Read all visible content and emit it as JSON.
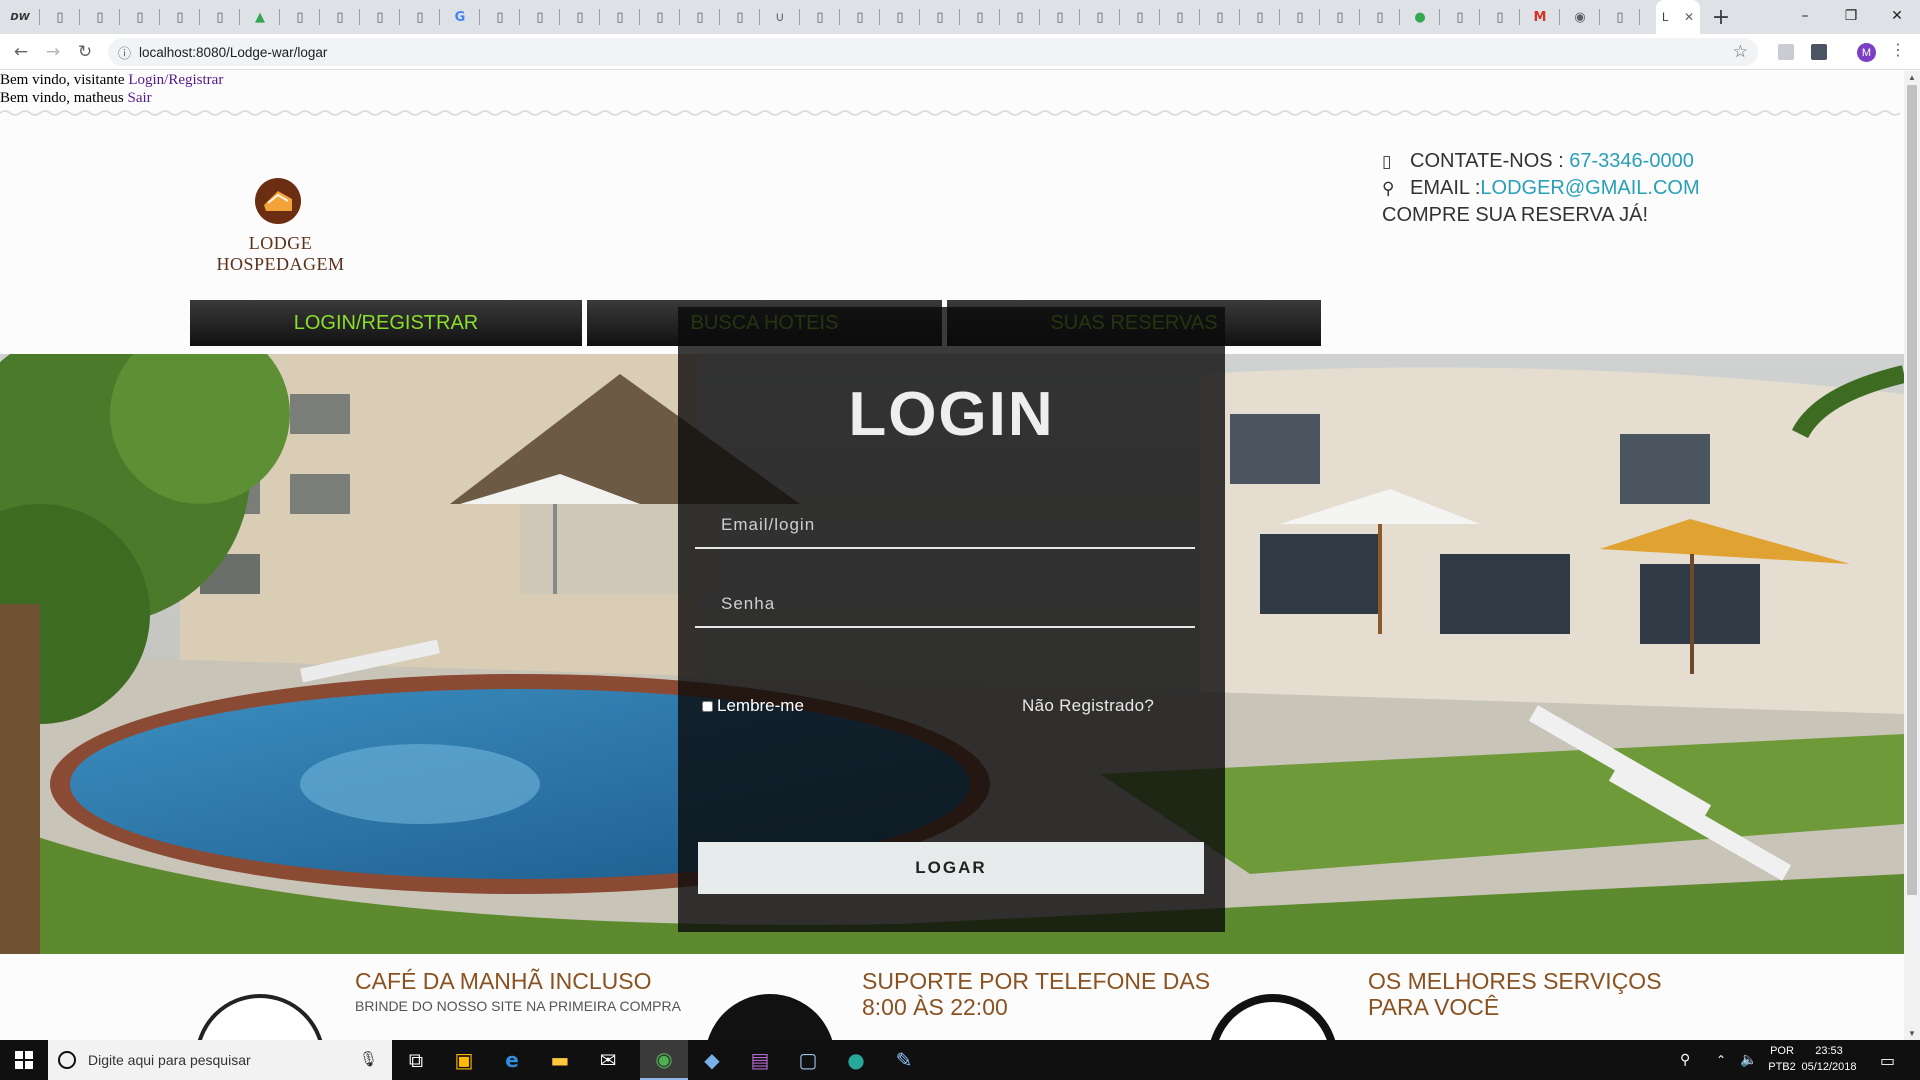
{
  "browser": {
    "tab_icons": [
      "dw",
      "file",
      "file",
      "file",
      "file",
      "file",
      "drive",
      "file",
      "file",
      "file",
      "file",
      "google",
      "file",
      "file",
      "file",
      "file",
      "file",
      "file",
      "file",
      "horseshoe",
      "file",
      "file",
      "file",
      "file",
      "file",
      "file",
      "file",
      "file",
      "file",
      "file",
      "file",
      "file",
      "file",
      "file",
      "file",
      "chrome-ext",
      "file",
      "file",
      "gmail",
      "github",
      "file"
    ],
    "active_tab_title": "L",
    "active_tab_close": "✕",
    "new_tab": "+",
    "window_controls": {
      "minimize": "–",
      "maximize": "❐",
      "close": "✕"
    },
    "url": "localhost:8080/Lodge-war/logar",
    "profile_initial": "M"
  },
  "page": {
    "welcome_visitor": "Bem vindo, visitante ",
    "welcome_visitor_link": "Login/Registrar",
    "welcome_user": "Bem vindo, matheus ",
    "welcome_user_link": "Sair",
    "logo_text": "LODGE HOSPEDAGEM",
    "contact": {
      "phone_label": "CONTATE-NOS : ",
      "phone": "67-3346-0000",
      "email_label": "EMAIL :",
      "email": "LODGER@GMAIL.COM",
      "cta": "COMPRE SUA RESERVA JÁ!"
    },
    "nav": [
      "LOGIN/REGISTRAR",
      "BUSCA HOTEIS",
      "SUAS RESERVAS"
    ],
    "login": {
      "title": "LOGIN",
      "email_placeholder": "Email/login",
      "password_placeholder": "Senha",
      "remember": "Lembre-me",
      "not_registered": "Não Registrado?",
      "submit": "LOGAR"
    },
    "features": [
      {
        "title": "CAFÉ DA MANHÃ INCLUSO",
        "subtitle": "BRINDE DO NOSSO SITE NA PRIMEIRA COMPRA"
      },
      {
        "title_line1": "SUPORTE POR TELEFONE DAS",
        "title_line2": "8:00 ÀS 22:00"
      },
      {
        "title_line1": "OS MELHORES SERVIÇOS",
        "title_line2": "PARA VOCÊ"
      }
    ],
    "colors": {
      "nav_text": "#8bdf2a",
      "link_teal": "#2a9fb8",
      "brand_brown": "#5a3119",
      "feature_brown": "#8a5220"
    }
  },
  "taskbar": {
    "search_placeholder": "Digite aqui para pesquisar",
    "apps": [
      "task-view",
      "store",
      "edge",
      "file-explorer",
      "mail",
      "chrome",
      "virtualbox",
      "winrar",
      "notepad",
      "app-teal",
      "paint"
    ],
    "lang_top": "POR",
    "lang_bottom": "PTB2",
    "time": "23:53",
    "date": "05/12/2018"
  }
}
